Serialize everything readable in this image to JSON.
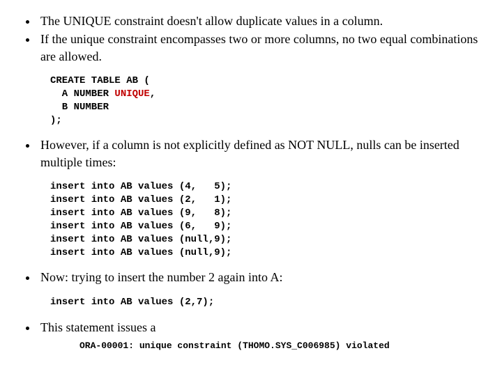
{
  "bullets": {
    "b1": "The UNIQUE constraint doesn't allow duplicate values in a column.",
    "b2": "If the unique constraint encompasses two or more columns, no two equal combinations are allowed.",
    "b3": "However, if a column is not explicitly defined as NOT NULL, nulls can be inserted multiple times:",
    "b4": "Now: trying to insert the number 2 again into A:",
    "b5": "This statement issues a"
  },
  "code": {
    "create_l1": "CREATE TABLE AB (",
    "create_l2a": "  A NUMBER ",
    "create_l2_kw": "UNIQUE",
    "create_l2b": ",",
    "create_l3": "  B NUMBER",
    "create_l4": ");",
    "ins1": "insert into AB values (4,   5);",
    "ins2": "insert into AB values (2,   1);",
    "ins3": "insert into AB values (9,   8);",
    "ins4": "insert into AB values (6,   9);",
    "ins5": "insert into AB values (null,9);",
    "ins6": "insert into AB values (null,9);",
    "ins7": "insert into AB values (2,7);",
    "error": "ORA-00001: unique constraint (THOMO.SYS_C006985) violated"
  }
}
